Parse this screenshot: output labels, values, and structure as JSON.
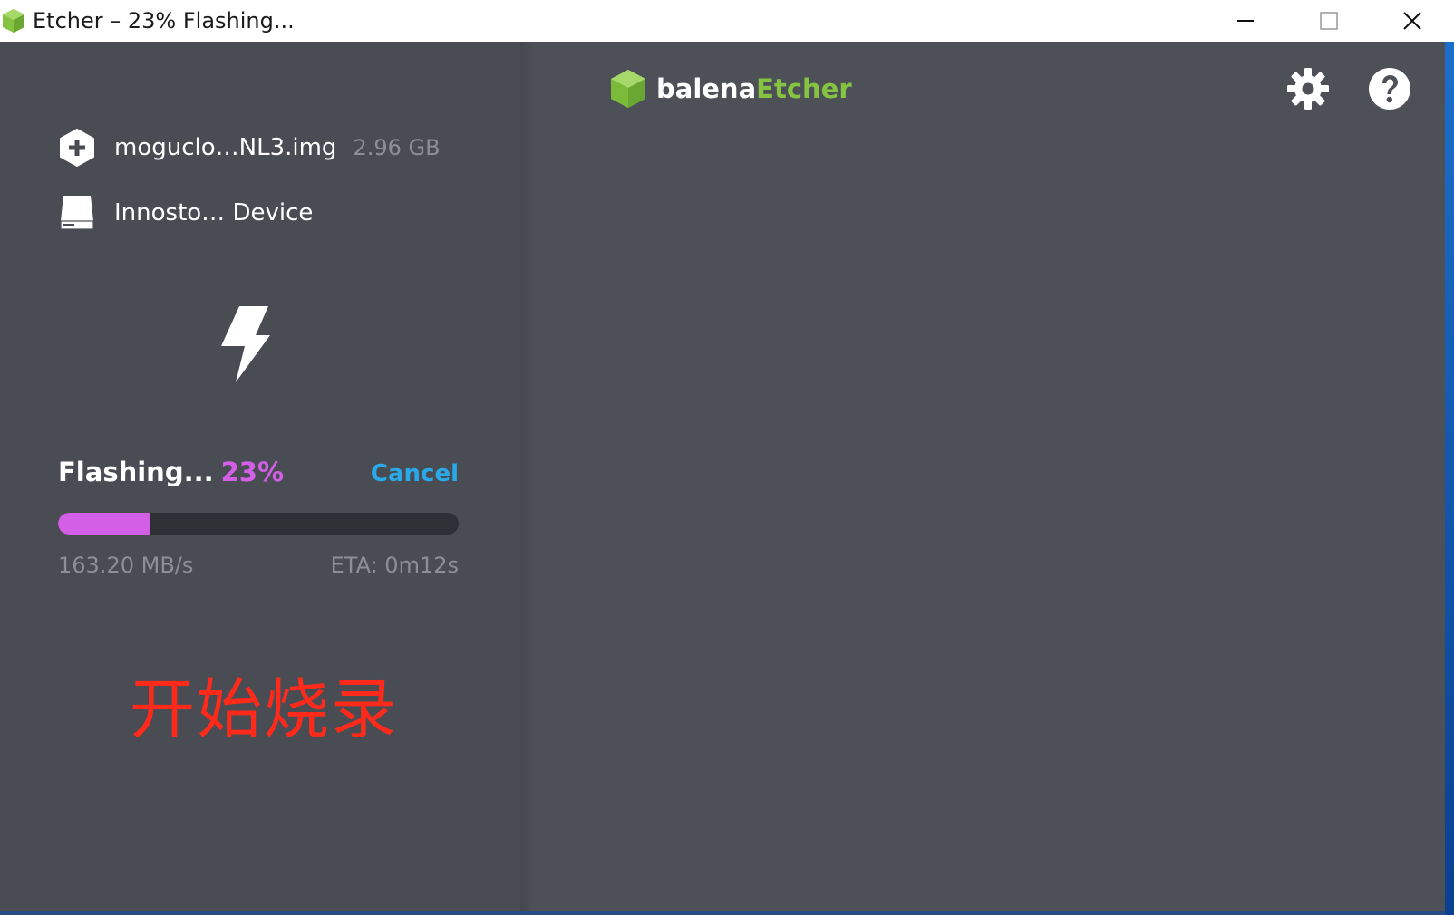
{
  "window": {
    "title": "Etcher – 23% Flashing...",
    "controls": [
      "minimize-icon",
      "maximize-icon",
      "close-icon"
    ]
  },
  "brand": {
    "part1": "balena",
    "part2": "Etcher",
    "accent_color": "#84c441"
  },
  "toolbar": {
    "icons": [
      "gear-icon",
      "help-icon"
    ]
  },
  "image": {
    "name": "moguclo…NL3.img",
    "size": "2.96 GB",
    "icon": "plus-hexagon-icon"
  },
  "drive": {
    "name": "Innosto… Device",
    "icon": "drive-icon"
  },
  "flash": {
    "status": "Flashing...",
    "percent_text": "23%",
    "progress": 0.23,
    "cancel_label": "Cancel",
    "speed": "163.20 MB/s",
    "eta": "ETA: 0m12s",
    "progress_color": "#d35fe6",
    "cancel_color": "#2aa9ea"
  },
  "annotation": {
    "text": "开始烧录",
    "color": "#ff2a1a"
  }
}
